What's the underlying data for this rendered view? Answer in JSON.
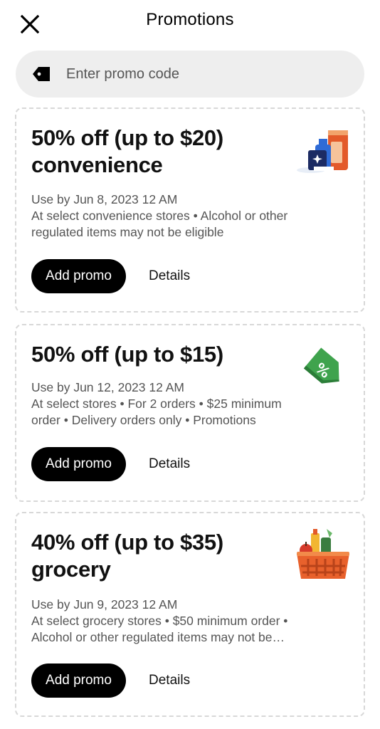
{
  "header": {
    "title": "Promotions",
    "close_icon": "close-icon"
  },
  "search": {
    "placeholder": "Enter promo code",
    "icon": "tag-icon"
  },
  "promos": [
    {
      "title": "50% off (up to $20) convenience",
      "use_by": "Use by Jun 8, 2023 12 AM",
      "description": "At select convenience stores • Alcohol or other regulated items may not be eligible",
      "add_label": "Add promo",
      "details_label": "Details",
      "illustration": "convenience-items-icon"
    },
    {
      "title": "50% off (up to $15)",
      "use_by": "Use by Jun 12, 2023 12 AM",
      "description": "At select stores • For 2 orders • $25 minimum order • Delivery orders only • Promotions",
      "add_label": "Add promo",
      "details_label": "Details",
      "illustration": "percent-tag-icon"
    },
    {
      "title": "40% off (up to $35) grocery",
      "use_by": "Use by Jun 9, 2023 12 AM",
      "description": "At select grocery stores • $50 minimum order • Alcohol or other regulated items may not be eligible",
      "add_label": "Add promo",
      "details_label": "Details",
      "illustration": "grocery-basket-icon"
    }
  ],
  "colors": {
    "primary_button": "#000000",
    "search_bg": "#eeeeee",
    "card_border": "#d8d8d8",
    "secondary_text": "#555555",
    "tag_green": "#3fa34d"
  }
}
